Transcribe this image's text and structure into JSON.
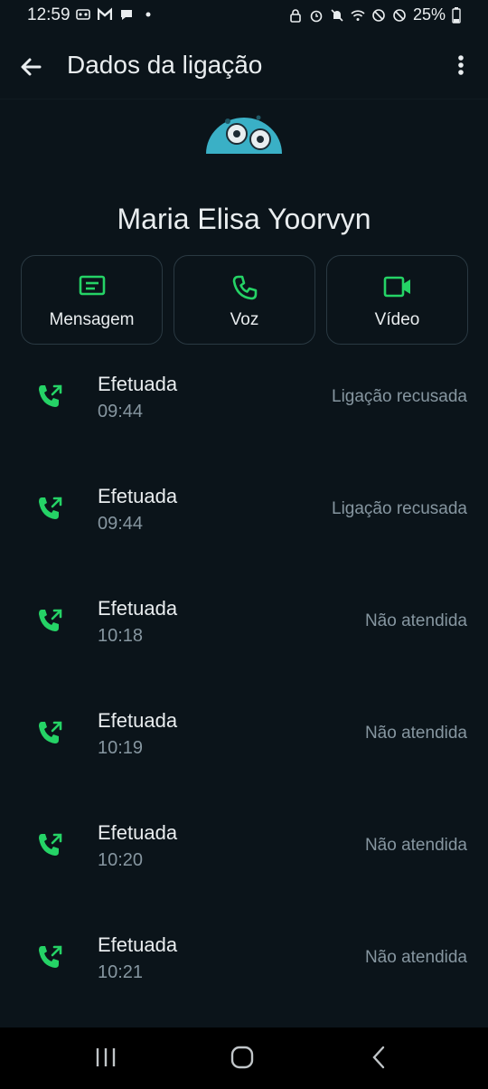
{
  "status_bar": {
    "time": "12:59",
    "battery": "25%"
  },
  "app_bar": {
    "title": "Dados da ligação"
  },
  "contact": {
    "name": "Maria Elisa Yoorvyn"
  },
  "actions": [
    {
      "label": "Mensagem",
      "icon": "message-icon"
    },
    {
      "label": "Voz",
      "icon": "phone-icon"
    },
    {
      "label": "Vídeo",
      "icon": "video-icon"
    }
  ],
  "calls": [
    {
      "type": "Efetuada",
      "time": "09:44",
      "status": "Ligação recusada"
    },
    {
      "type": "Efetuada",
      "time": "09:44",
      "status": "Ligação recusada"
    },
    {
      "type": "Efetuada",
      "time": "10:18",
      "status": "Não atendida"
    },
    {
      "type": "Efetuada",
      "time": "10:19",
      "status": "Não atendida"
    },
    {
      "type": "Efetuada",
      "time": "10:20",
      "status": "Não atendida"
    },
    {
      "type": "Efetuada",
      "time": "10:21",
      "status": "Não atendida"
    }
  ],
  "colors": {
    "background": "#0b141a",
    "accent": "#25d366",
    "text_primary": "#e9edef",
    "text_secondary": "#8696a0"
  }
}
